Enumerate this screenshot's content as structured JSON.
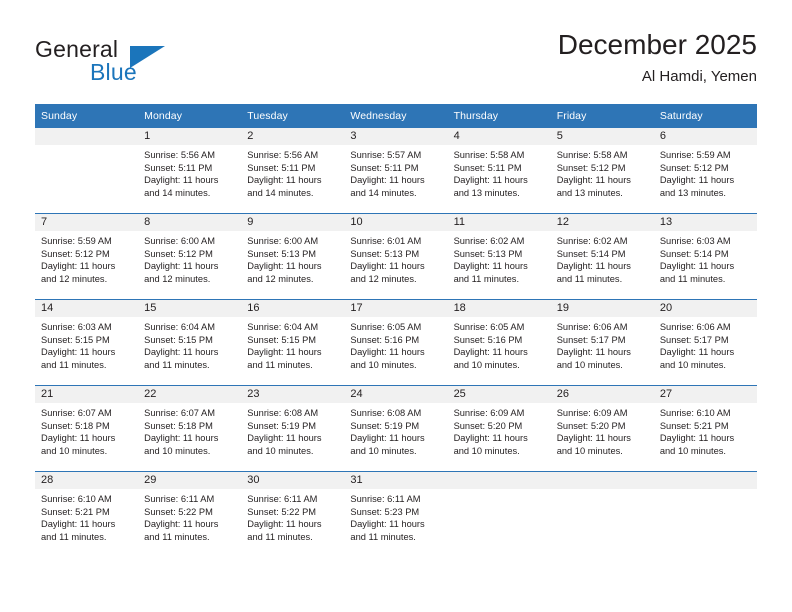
{
  "brand": {
    "name_top": "General",
    "name_bottom": "Blue",
    "accent_color": "#1b75bb",
    "triangle_icon": "triangle-icon"
  },
  "header": {
    "title": "December 2025",
    "subtitle": "Al Hamdi, Yemen",
    "header_bg": "#2e75b6",
    "band_bg": "#f1f1f1"
  },
  "calendar": {
    "weekday_headers": [
      "Sunday",
      "Monday",
      "Tuesday",
      "Wednesday",
      "Thursday",
      "Friday",
      "Saturday"
    ],
    "weeks": [
      [
        {
          "day": "",
          "sunrise": "",
          "sunset": "",
          "daylight": ""
        },
        {
          "day": "1",
          "sunrise": "Sunrise: 5:56 AM",
          "sunset": "Sunset: 5:11 PM",
          "daylight": "Daylight: 11 hours and 14 minutes."
        },
        {
          "day": "2",
          "sunrise": "Sunrise: 5:56 AM",
          "sunset": "Sunset: 5:11 PM",
          "daylight": "Daylight: 11 hours and 14 minutes."
        },
        {
          "day": "3",
          "sunrise": "Sunrise: 5:57 AM",
          "sunset": "Sunset: 5:11 PM",
          "daylight": "Daylight: 11 hours and 14 minutes."
        },
        {
          "day": "4",
          "sunrise": "Sunrise: 5:58 AM",
          "sunset": "Sunset: 5:11 PM",
          "daylight": "Daylight: 11 hours and 13 minutes."
        },
        {
          "day": "5",
          "sunrise": "Sunrise: 5:58 AM",
          "sunset": "Sunset: 5:12 PM",
          "daylight": "Daylight: 11 hours and 13 minutes."
        },
        {
          "day": "6",
          "sunrise": "Sunrise: 5:59 AM",
          "sunset": "Sunset: 5:12 PM",
          "daylight": "Daylight: 11 hours and 13 minutes."
        }
      ],
      [
        {
          "day": "7",
          "sunrise": "Sunrise: 5:59 AM",
          "sunset": "Sunset: 5:12 PM",
          "daylight": "Daylight: 11 hours and 12 minutes."
        },
        {
          "day": "8",
          "sunrise": "Sunrise: 6:00 AM",
          "sunset": "Sunset: 5:12 PM",
          "daylight": "Daylight: 11 hours and 12 minutes."
        },
        {
          "day": "9",
          "sunrise": "Sunrise: 6:00 AM",
          "sunset": "Sunset: 5:13 PM",
          "daylight": "Daylight: 11 hours and 12 minutes."
        },
        {
          "day": "10",
          "sunrise": "Sunrise: 6:01 AM",
          "sunset": "Sunset: 5:13 PM",
          "daylight": "Daylight: 11 hours and 12 minutes."
        },
        {
          "day": "11",
          "sunrise": "Sunrise: 6:02 AM",
          "sunset": "Sunset: 5:13 PM",
          "daylight": "Daylight: 11 hours and 11 minutes."
        },
        {
          "day": "12",
          "sunrise": "Sunrise: 6:02 AM",
          "sunset": "Sunset: 5:14 PM",
          "daylight": "Daylight: 11 hours and 11 minutes."
        },
        {
          "day": "13",
          "sunrise": "Sunrise: 6:03 AM",
          "sunset": "Sunset: 5:14 PM",
          "daylight": "Daylight: 11 hours and 11 minutes."
        }
      ],
      [
        {
          "day": "14",
          "sunrise": "Sunrise: 6:03 AM",
          "sunset": "Sunset: 5:15 PM",
          "daylight": "Daylight: 11 hours and 11 minutes."
        },
        {
          "day": "15",
          "sunrise": "Sunrise: 6:04 AM",
          "sunset": "Sunset: 5:15 PM",
          "daylight": "Daylight: 11 hours and 11 minutes."
        },
        {
          "day": "16",
          "sunrise": "Sunrise: 6:04 AM",
          "sunset": "Sunset: 5:15 PM",
          "daylight": "Daylight: 11 hours and 11 minutes."
        },
        {
          "day": "17",
          "sunrise": "Sunrise: 6:05 AM",
          "sunset": "Sunset: 5:16 PM",
          "daylight": "Daylight: 11 hours and 10 minutes."
        },
        {
          "day": "18",
          "sunrise": "Sunrise: 6:05 AM",
          "sunset": "Sunset: 5:16 PM",
          "daylight": "Daylight: 11 hours and 10 minutes."
        },
        {
          "day": "19",
          "sunrise": "Sunrise: 6:06 AM",
          "sunset": "Sunset: 5:17 PM",
          "daylight": "Daylight: 11 hours and 10 minutes."
        },
        {
          "day": "20",
          "sunrise": "Sunrise: 6:06 AM",
          "sunset": "Sunset: 5:17 PM",
          "daylight": "Daylight: 11 hours and 10 minutes."
        }
      ],
      [
        {
          "day": "21",
          "sunrise": "Sunrise: 6:07 AM",
          "sunset": "Sunset: 5:18 PM",
          "daylight": "Daylight: 11 hours and 10 minutes."
        },
        {
          "day": "22",
          "sunrise": "Sunrise: 6:07 AM",
          "sunset": "Sunset: 5:18 PM",
          "daylight": "Daylight: 11 hours and 10 minutes."
        },
        {
          "day": "23",
          "sunrise": "Sunrise: 6:08 AM",
          "sunset": "Sunset: 5:19 PM",
          "daylight": "Daylight: 11 hours and 10 minutes."
        },
        {
          "day": "24",
          "sunrise": "Sunrise: 6:08 AM",
          "sunset": "Sunset: 5:19 PM",
          "daylight": "Daylight: 11 hours and 10 minutes."
        },
        {
          "day": "25",
          "sunrise": "Sunrise: 6:09 AM",
          "sunset": "Sunset: 5:20 PM",
          "daylight": "Daylight: 11 hours and 10 minutes."
        },
        {
          "day": "26",
          "sunrise": "Sunrise: 6:09 AM",
          "sunset": "Sunset: 5:20 PM",
          "daylight": "Daylight: 11 hours and 10 minutes."
        },
        {
          "day": "27",
          "sunrise": "Sunrise: 6:10 AM",
          "sunset": "Sunset: 5:21 PM",
          "daylight": "Daylight: 11 hours and 10 minutes."
        }
      ],
      [
        {
          "day": "28",
          "sunrise": "Sunrise: 6:10 AM",
          "sunset": "Sunset: 5:21 PM",
          "daylight": "Daylight: 11 hours and 11 minutes."
        },
        {
          "day": "29",
          "sunrise": "Sunrise: 6:11 AM",
          "sunset": "Sunset: 5:22 PM",
          "daylight": "Daylight: 11 hours and 11 minutes."
        },
        {
          "day": "30",
          "sunrise": "Sunrise: 6:11 AM",
          "sunset": "Sunset: 5:22 PM",
          "daylight": "Daylight: 11 hours and 11 minutes."
        },
        {
          "day": "31",
          "sunrise": "Sunrise: 6:11 AM",
          "sunset": "Sunset: 5:23 PM",
          "daylight": "Daylight: 11 hours and 11 minutes."
        },
        {
          "day": "",
          "sunrise": "",
          "sunset": "",
          "daylight": ""
        },
        {
          "day": "",
          "sunrise": "",
          "sunset": "",
          "daylight": ""
        },
        {
          "day": "",
          "sunrise": "",
          "sunset": "",
          "daylight": ""
        }
      ]
    ]
  }
}
